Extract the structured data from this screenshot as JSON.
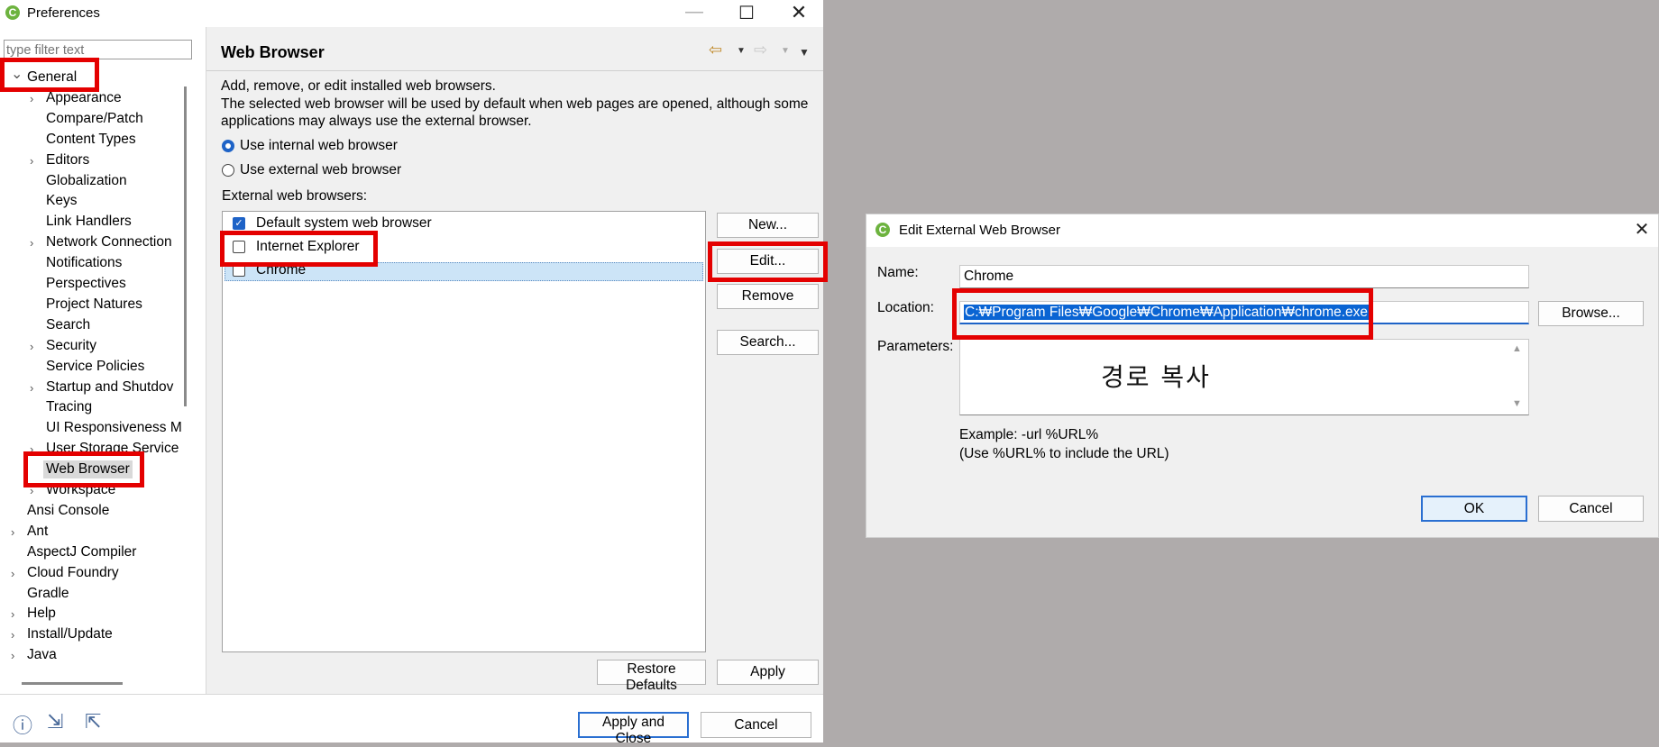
{
  "prefs": {
    "title": "Preferences",
    "filter_placeholder": "type filter text",
    "page_title": "Web Browser",
    "intro_line1": "Add, remove, or edit installed web browsers.",
    "intro_line2": "The selected web browser will be used by default when web pages are opened, although some",
    "intro_line3": "applications may always use the external browser.",
    "radio_internal": "Use internal web browser",
    "radio_external": "Use external web browser",
    "radio_selected": "internal",
    "external_label": "External web browsers:",
    "browsers": [
      {
        "name": "Default system web browser",
        "checked": true
      },
      {
        "name": "Internet Explorer",
        "checked": false
      },
      {
        "name": "Chrome",
        "checked": false,
        "selected": true
      }
    ],
    "buttons": {
      "new": "New...",
      "edit": "Edit...",
      "remove": "Remove",
      "search": "Search...",
      "restore_defaults": "Restore Defaults",
      "apply": "Apply",
      "apply_close": "Apply and Close",
      "cancel": "Cancel"
    },
    "tree": [
      {
        "label": "General",
        "level": 0,
        "expanded": true
      },
      {
        "label": "Appearance",
        "level": 1,
        "chevron": true
      },
      {
        "label": "Compare/Patch",
        "level": 1
      },
      {
        "label": "Content Types",
        "level": 1
      },
      {
        "label": "Editors",
        "level": 1,
        "chevron": true
      },
      {
        "label": "Globalization",
        "level": 1
      },
      {
        "label": "Keys",
        "level": 1
      },
      {
        "label": "Link Handlers",
        "level": 1
      },
      {
        "label": "Network Connection",
        "level": 1,
        "chevron": true
      },
      {
        "label": "Notifications",
        "level": 1
      },
      {
        "label": "Perspectives",
        "level": 1
      },
      {
        "label": "Project Natures",
        "level": 1
      },
      {
        "label": "Search",
        "level": 1
      },
      {
        "label": "Security",
        "level": 1,
        "chevron": true
      },
      {
        "label": "Service Policies",
        "level": 1
      },
      {
        "label": "Startup and Shutdov",
        "level": 1,
        "chevron": true
      },
      {
        "label": "Tracing",
        "level": 1
      },
      {
        "label": "UI Responsiveness M",
        "level": 1
      },
      {
        "label": "User Storage Service",
        "level": 1,
        "chevron": true
      },
      {
        "label": "Web Browser",
        "level": 1,
        "selected": true
      },
      {
        "label": "Workspace",
        "level": 1,
        "chevron": true
      },
      {
        "label": "Ansi Console",
        "level": 0
      },
      {
        "label": "Ant",
        "level": 0,
        "chevron": true
      },
      {
        "label": "AspectJ Compiler",
        "level": 0
      },
      {
        "label": "Cloud Foundry",
        "level": 0,
        "chevron": true
      },
      {
        "label": "Gradle",
        "level": 0
      },
      {
        "label": "Help",
        "level": 0,
        "chevron": true
      },
      {
        "label": "Install/Update",
        "level": 0,
        "chevron": true
      },
      {
        "label": "Java",
        "level": 0,
        "chevron": true
      }
    ]
  },
  "dialog": {
    "title": "Edit External Web Browser",
    "name_label": "Name:",
    "name_value": "Chrome",
    "location_label": "Location:",
    "location_value": "C:₩Program Files₩Google₩Chrome₩Application₩chrome.exe",
    "parameters_label": "Parameters:",
    "annotation": "경로 복사",
    "browse": "Browse...",
    "example_line1": "Example: -url %URL%",
    "example_line2": "(Use %URL% to include the URL)",
    "ok": "OK",
    "cancel": "Cancel"
  },
  "colors": {
    "highlight_box": "#e40000",
    "accent": "#1e63c7",
    "selection": "#cce4f7",
    "backdrop": "#afabab"
  }
}
